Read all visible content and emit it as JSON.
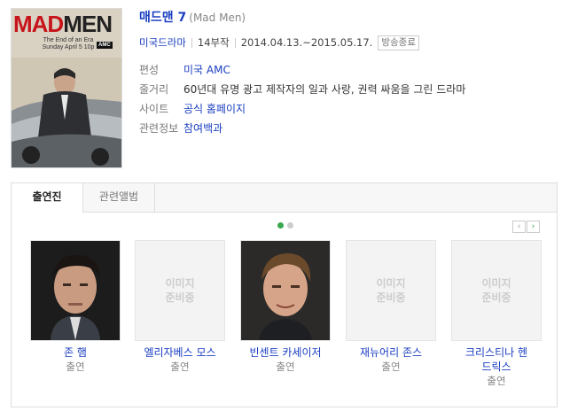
{
  "poster": {
    "logo_part1": "MAD",
    "logo_part2": "MEN",
    "tagline": "The End of an Era\nSunday April 5 10p",
    "network_badge": "AMC"
  },
  "title": {
    "main": "매드맨 7",
    "original": "(Mad Men)"
  },
  "meta": {
    "genre": "미국드라마",
    "episodes": "14부작",
    "dates": "2014.04.13.~2015.05.17.",
    "status": "방송종료"
  },
  "info": [
    {
      "label": "편성",
      "value": "미국 AMC",
      "link": true
    },
    {
      "label": "줄거리",
      "value": "60년대 유명 광고 제작자의 일과 사랑, 권력 싸움을 그린 드라마",
      "link": false
    },
    {
      "label": "사이트",
      "value": "공식 홈페이지",
      "link": true
    },
    {
      "label": "관련정보",
      "value": "참여백과",
      "link": true
    }
  ],
  "tabs": [
    {
      "label": "출연진",
      "active": true
    },
    {
      "label": "관련앨범",
      "active": false
    }
  ],
  "pager": {
    "prev": "‹",
    "next": "›"
  },
  "cast": [
    {
      "name": "존 햄",
      "role": "출연",
      "has_photo": true,
      "placeholder": ""
    },
    {
      "name": "엘리자베스 모스",
      "role": "출연",
      "has_photo": false,
      "placeholder": "이미지\n준비중"
    },
    {
      "name": "빈센트 카세이저",
      "role": "출연",
      "has_photo": true,
      "placeholder": ""
    },
    {
      "name": "재뉴어리 존스",
      "role": "출연",
      "has_photo": false,
      "placeholder": "이미지\n준비중"
    },
    {
      "name": "크리스티나 헨드릭스",
      "role": "출연",
      "has_photo": false,
      "placeholder": "이미지\n준비중"
    }
  ],
  "colors": {
    "link": "#1a3ec1",
    "accent_green": "#3aa84b",
    "poster_red": "#c7141b"
  }
}
